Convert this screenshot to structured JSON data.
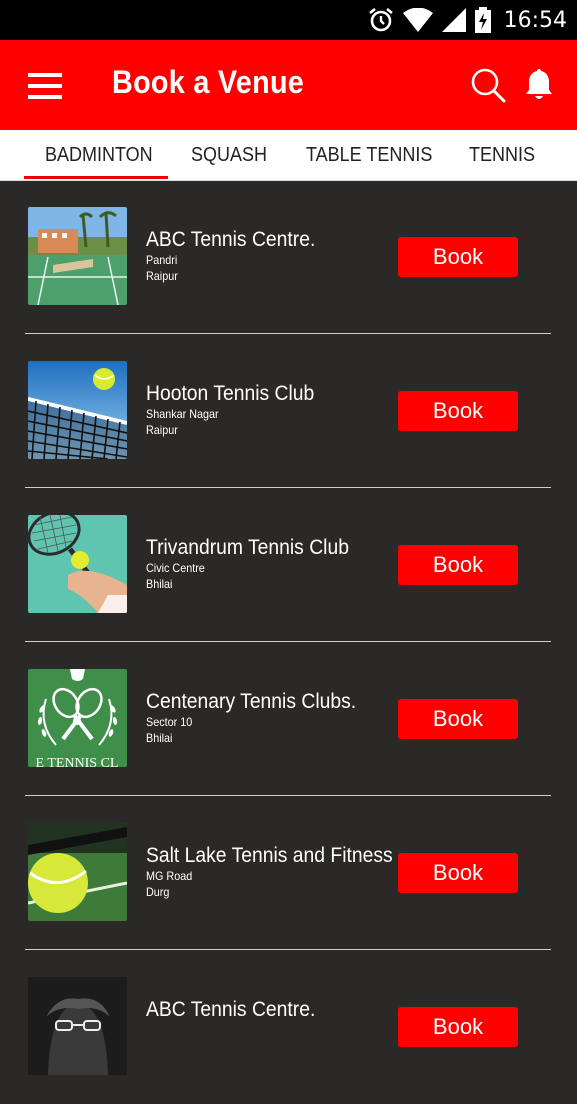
{
  "status": {
    "time": "16:54"
  },
  "appbar": {
    "title": "Book a Venue"
  },
  "tabs": [
    {
      "label": "BADMINTON",
      "selected": true
    },
    {
      "label": "SQUASH"
    },
    {
      "label": "TABLE TENNIS"
    },
    {
      "label": "TENNIS"
    }
  ],
  "venues": [
    {
      "name": "ABC Tennis Centre.",
      "area": "Pandri",
      "city": "Raipur",
      "button": "Book"
    },
    {
      "name": "Hooton Tennis Club",
      "area": "Shankar Nagar",
      "city": "Raipur",
      "button": "Book"
    },
    {
      "name": "Trivandrum Tennis Club",
      "area": "Civic Centre",
      "city": "Bhilai",
      "button": "Book"
    },
    {
      "name": "Centenary Tennis Clubs.",
      "area": "Sector 10",
      "city": "Bhilai",
      "button": "Book",
      "logo_text": "E TENNIS CL"
    },
    {
      "name": "Salt Lake Tennis and Fitness",
      "area": "MG Road",
      "city": "Durg",
      "button": "Book"
    },
    {
      "name": "ABC Tennis Centre.",
      "area": "",
      "city": "",
      "button": "Book"
    }
  ],
  "colors": {
    "accent": "#fe0000",
    "background": "#2b2927"
  }
}
